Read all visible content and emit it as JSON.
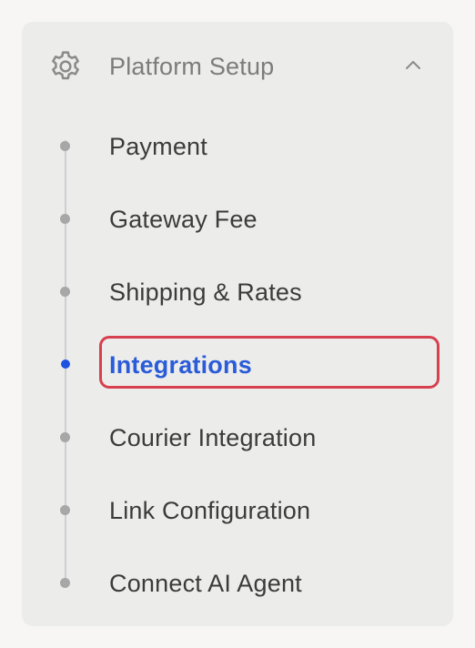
{
  "section": {
    "title": "Platform Setup",
    "expanded": true,
    "icon": "gear-icon",
    "toggle_icon": "chevron-up-icon"
  },
  "items": [
    {
      "label": "Payment",
      "active": false
    },
    {
      "label": "Gateway Fee",
      "active": false
    },
    {
      "label": "Shipping & Rates",
      "active": false
    },
    {
      "label": "Integrations",
      "active": true
    },
    {
      "label": "Courier Integration",
      "active": false
    },
    {
      "label": "Link Configuration",
      "active": false
    },
    {
      "label": "Connect AI Agent",
      "active": false
    }
  ],
  "colors": {
    "active_text": "#2a5bd8",
    "active_dot": "#1f51e0",
    "highlight_border": "#d7404f",
    "inactive_text": "#3b3b3b",
    "header_text": "#7c7c7c",
    "panel_bg": "#ececeb"
  }
}
